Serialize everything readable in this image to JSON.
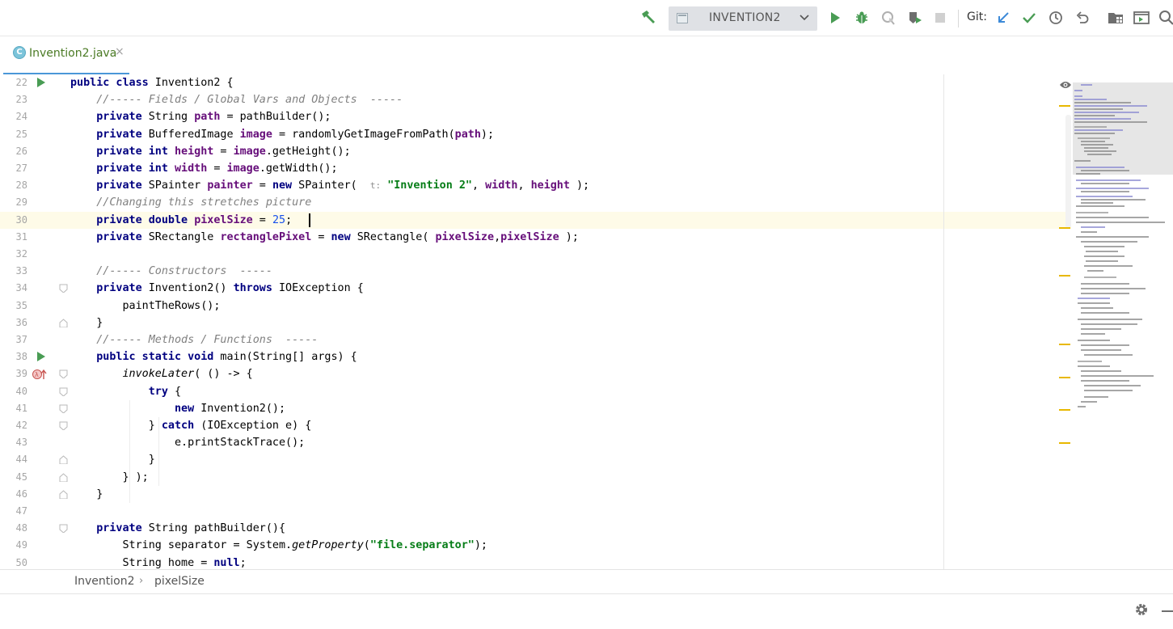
{
  "toolbar": {
    "run_config": "INVENTION2",
    "git_label": "Git:",
    "icons": [
      "build-hammer-icon",
      "run-icon",
      "debug-icon",
      "coverage-icon",
      "profile-icon",
      "stop-icon",
      "git-update-icon",
      "git-commit-icon",
      "git-history-icon",
      "git-rollback-icon",
      "project-structure-icon",
      "run-anything-icon",
      "search-icon"
    ]
  },
  "tab": {
    "label": "Invention2.java",
    "icon": "C",
    "close": "×"
  },
  "editor": {
    "lines": [
      {
        "n": "22",
        "html": "<span class=\"kw\">public class</span> Invention2 {"
      },
      {
        "n": "23",
        "html": "    <span class=\"cm\">//----- Fields / Global Vars and Objects  -----</span>"
      },
      {
        "n": "24",
        "html": "    <span class=\"kw\">private</span> String <span class=\"fld\">path</span> = pathBuilder();"
      },
      {
        "n": "25",
        "html": "    <span class=\"kw\">private</span> BufferedImage <span class=\"fld\">image</span> = randomlyGetImageFromPath(<span class=\"fld\">path</span>);"
      },
      {
        "n": "26",
        "html": "    <span class=\"kw\">private int</span> <span class=\"fld\">height</span> = <span class=\"fld\">image</span>.getHeight();"
      },
      {
        "n": "27",
        "html": "    <span class=\"kw\">private int</span> <span class=\"fld\">width</span> = <span class=\"fld\">image</span>.getWidth();"
      },
      {
        "n": "28",
        "html": "    <span class=\"kw\">private</span> SPainter <span class=\"fld\">painter</span> = <span class=\"kw\">new</span> SPainter(  <span class=\"hint\">t:</span> <span class=\"str\">\"Invention 2\"</span>, <span class=\"fld\">width</span>, <span class=\"fld\">height</span> );"
      },
      {
        "n": "29",
        "html": "    <span class=\"cm\">//Changing this stretches picture</span>"
      },
      {
        "n": "30",
        "html": "    <span class=\"kw\">private double</span> <span class=\"fld\">pixelSize</span> = <span class=\"num\">25</span>;"
      },
      {
        "n": "31",
        "html": "    <span class=\"kw\">private</span> SRectangle <span class=\"fld\">rectanglePixel</span> = <span class=\"kw\">new</span> SRectangle( <span class=\"fld\">pixelSize</span>,<span class=\"fld\">pixelSize</span> );"
      },
      {
        "n": "32",
        "html": ""
      },
      {
        "n": "33",
        "html": "    <span class=\"cm\">//----- Constructors  -----</span>"
      },
      {
        "n": "34",
        "html": "    <span class=\"kw\">private</span> Invention2() <span class=\"kw\">throws</span> IOException {"
      },
      {
        "n": "35",
        "html": "        paintTheRows();"
      },
      {
        "n": "36",
        "html": "    }"
      },
      {
        "n": "37",
        "html": "    <span class=\"cm\">//----- Methods / Functions  -----</span>"
      },
      {
        "n": "38",
        "html": "    <span class=\"kw\">public static void</span> main(String[] args) {"
      },
      {
        "n": "39",
        "html": "        <span class=\"st\">invokeLater</span>( () -> {"
      },
      {
        "n": "40",
        "html": "            <span class=\"kw\">try</span> {"
      },
      {
        "n": "41",
        "html": "                <span class=\"kw\">new</span> Invention2();"
      },
      {
        "n": "42",
        "html": "            } <span class=\"kw\">catch</span> (IOException e) {"
      },
      {
        "n": "43",
        "html": "                e.printStackTrace();"
      },
      {
        "n": "44",
        "html": "            }"
      },
      {
        "n": "45",
        "html": "        } );"
      },
      {
        "n": "46",
        "html": "    }"
      },
      {
        "n": "47",
        "html": ""
      },
      {
        "n": "48",
        "html": "    <span class=\"kw\">private</span> String pathBuilder(){"
      },
      {
        "n": "49",
        "html": "        String separator = System.<span class=\"st\">getProperty</span>(<span class=\"str\">\"file.separator\"</span>);"
      },
      {
        "n": "50",
        "html": "        String home = <span class=\"kw\">null</span>;"
      }
    ]
  },
  "breadcrumb": {
    "class": "Invention2",
    "member": "pixelSize"
  },
  "colors": {
    "accent": "#4a97d8",
    "run_green": "#499c54",
    "marker_yellow": "#e8b800"
  }
}
